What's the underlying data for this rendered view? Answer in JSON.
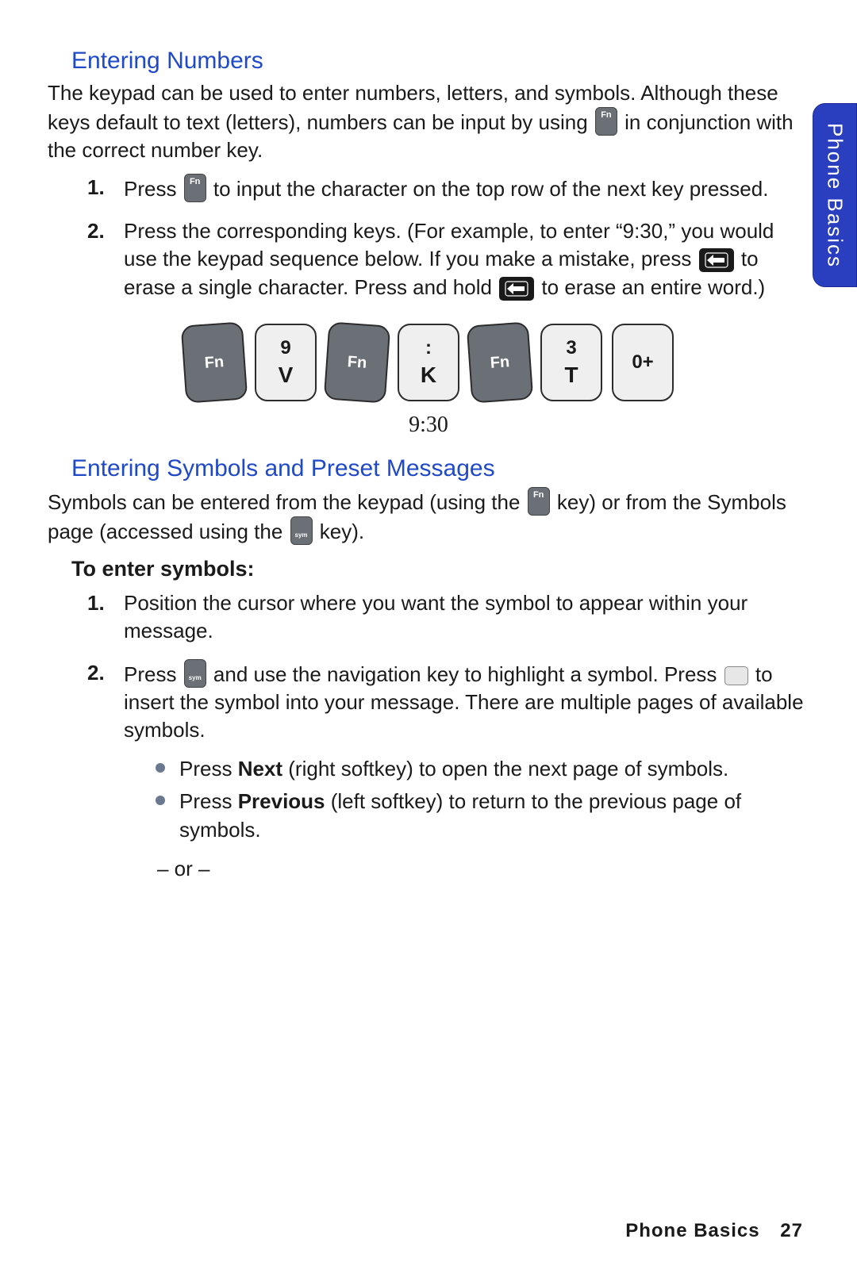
{
  "section_tab": "Phone Basics",
  "sec1": {
    "heading": "Entering Numbers",
    "intro_a": "The keypad can be used to enter numbers, letters, and symbols. Although these keys default to text (letters), numbers can be input by using ",
    "intro_b": " in conjunction with the correct number key.",
    "step1_a": "Press ",
    "step1_b": " to input the character on the top row of the next key pressed.",
    "step2_a": "Press the corresponding keys. (For example, to enter “9:30,” you would use the keypad sequence below. If you make a mistake, press ",
    "step2_b": " to erase a single character. Press and hold ",
    "step2_c": " to erase an entire word.)",
    "caption": "9:30",
    "keys": {
      "fn": "Fn",
      "k1_top": "9",
      "k1_bot": "V",
      "k2_top": ":",
      "k2_bot": "K",
      "k3_top": "3",
      "k3_bot": "T",
      "k4": "0+"
    }
  },
  "sec2": {
    "heading": "Entering Symbols and Preset Messages",
    "intro_a": "Symbols can be entered from the keypad (using the ",
    "intro_b": " key) or from the Symbols page (accessed using the ",
    "intro_c": " key).",
    "subhead": "To enter symbols:",
    "step1": "Position the cursor where you want the symbol to appear within your message.",
    "step2_a": "Press ",
    "step2_b": " and use the navigation key to highlight a symbol. Press ",
    "step2_c": " to insert the symbol into your message. There are multiple pages of available symbols.",
    "bullet1_a": "Press ",
    "bullet1_bold": "Next",
    "bullet1_b": " (right softkey) to open the next page of symbols.",
    "bullet2_a": "Press ",
    "bullet2_bold": "Previous",
    "bullet2_b": " (left softkey) to return to the previous page of symbols.",
    "or": "– or –"
  },
  "footer": {
    "label": "Phone Basics",
    "page": "27"
  },
  "icons": {
    "fn": "Fn",
    "sym": "sym"
  }
}
